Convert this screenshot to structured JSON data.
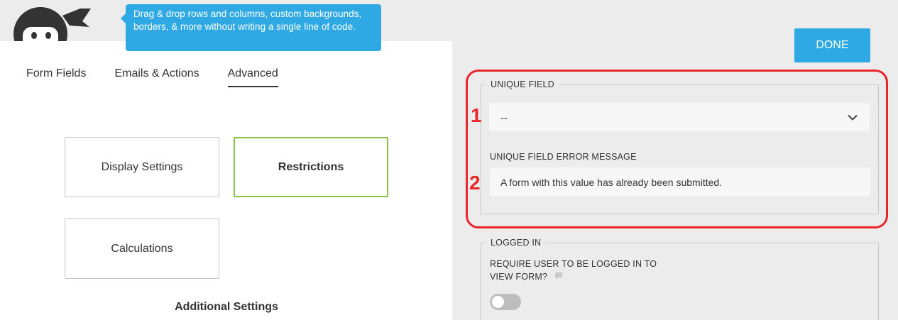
{
  "tooltip": {
    "text": "Drag & drop rows and columns, custom backgrounds, borders, & more without writing a single line of code."
  },
  "tabs": [
    {
      "label": "Form Fields",
      "active": false
    },
    {
      "label": "Emails & Actions",
      "active": false
    },
    {
      "label": "Advanced",
      "active": true
    }
  ],
  "cards": {
    "display_settings": "Display Settings",
    "restrictions": "Restrictions",
    "calculations": "Calculations"
  },
  "additional_settings": "Additional Settings",
  "done_label": "DONE",
  "unique_field": {
    "legend": "UNIQUE FIELD",
    "select_value": "--",
    "error_label": "UNIQUE FIELD ERROR MESSAGE",
    "error_value": "A form with this value has already been submitted."
  },
  "logged_in": {
    "legend": "LOGGED IN",
    "require_label_line1": "REQUIRE USER TO BE LOGGED IN TO",
    "require_label_line2": "VIEW FORM?",
    "toggle_on": false
  },
  "annotations": {
    "num1": "1",
    "num2": "2"
  },
  "colors": {
    "accent": "#2ea9e3",
    "active_border": "#8bc34a",
    "annotation": "#e8262b"
  },
  "icons": {
    "logo": "ninja-logo",
    "select_arrow": "chevron-down-icon",
    "help": "help-bubble-icon"
  }
}
